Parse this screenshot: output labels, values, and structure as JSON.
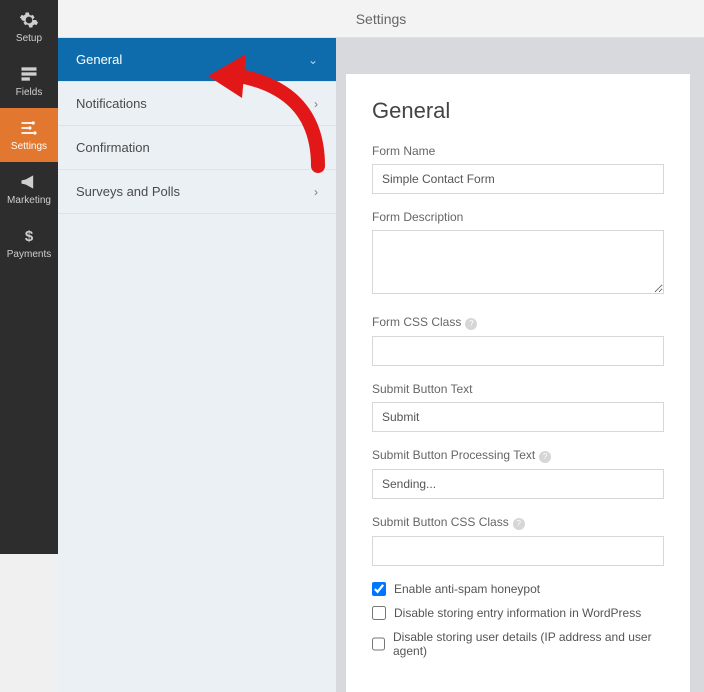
{
  "header": {
    "title": "Settings"
  },
  "left_nav": [
    {
      "label": "Setup"
    },
    {
      "label": "Fields"
    },
    {
      "label": "Settings"
    },
    {
      "label": "Marketing"
    },
    {
      "label": "Payments"
    }
  ],
  "sidebar": {
    "items": [
      {
        "label": "General"
      },
      {
        "label": "Notifications"
      },
      {
        "label": "Confirmation"
      },
      {
        "label": "Surveys and Polls"
      }
    ]
  },
  "panel": {
    "heading": "General",
    "form_name_label": "Form Name",
    "form_name_value": "Simple Contact Form",
    "form_description_label": "Form Description",
    "form_css_label": "Form CSS Class",
    "submit_text_label": "Submit Button Text",
    "submit_text_value": "Submit",
    "submit_processing_label": "Submit Button Processing Text",
    "submit_processing_value": "Sending...",
    "submit_css_label": "Submit Button CSS Class",
    "checks": [
      {
        "label": "Enable anti-spam honeypot",
        "checked": true
      },
      {
        "label": "Disable storing entry information in WordPress",
        "checked": false
      },
      {
        "label": "Disable storing user details (IP address and user agent)",
        "checked": false
      }
    ]
  }
}
